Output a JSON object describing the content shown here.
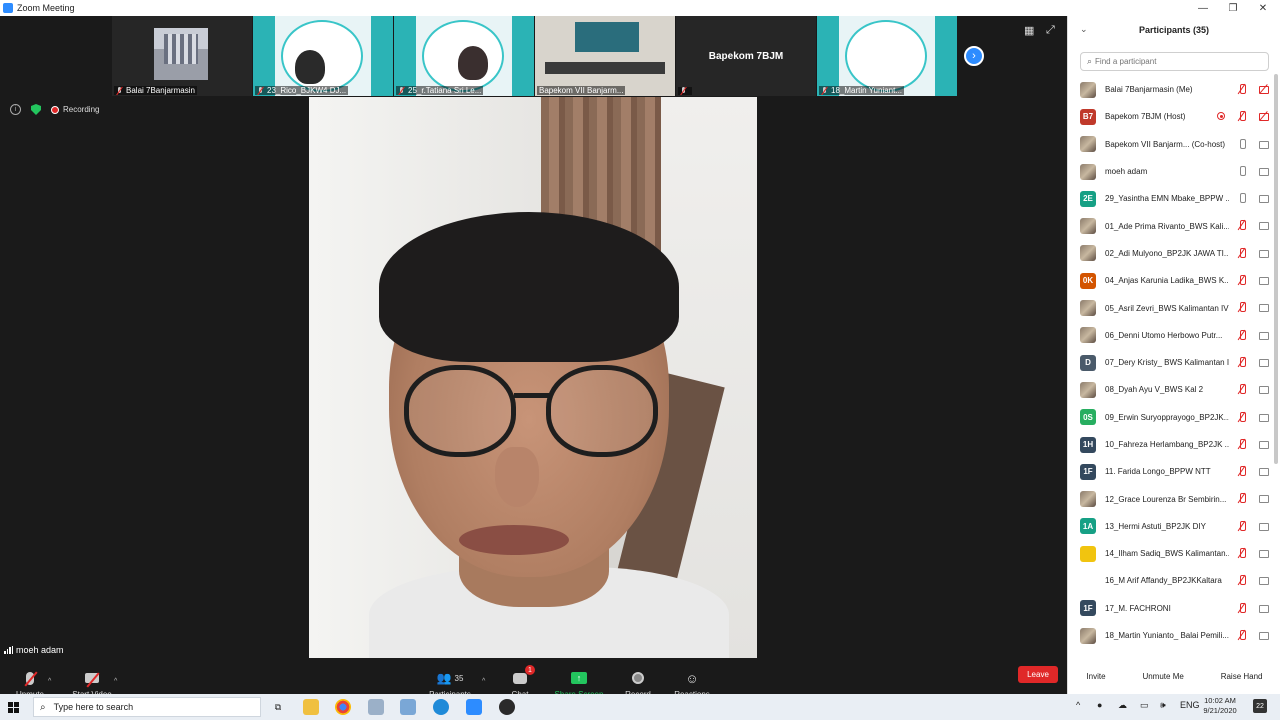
{
  "window": {
    "title": "Zoom Meeting",
    "minimize": "—",
    "restore": "❐",
    "close": "✕"
  },
  "thumbnails": [
    {
      "label": "Balai 7Banjarmasin",
      "kind": "building"
    },
    {
      "label": "23_Rico_BJKW4 DJ...",
      "kind": "slide-person"
    },
    {
      "label": "25_r.Tatiana Sri Le...",
      "kind": "slide-person"
    },
    {
      "label": "Bapekom VII Banjarm...",
      "kind": "room"
    },
    {
      "label": "Bapekom 7BJM",
      "kind": "name-only"
    },
    {
      "label": "18_Martin Yuniant...",
      "kind": "slide"
    }
  ],
  "status": {
    "recording_label": "Recording"
  },
  "speaker": {
    "name": "moeh adam"
  },
  "toolbar": {
    "unmute": "Unmute",
    "start_video": "Start Video",
    "participants": "Participants",
    "participants_count": "35",
    "chat": "Chat",
    "chat_badge": "1",
    "share_screen": "Share Screen",
    "record": "Record",
    "reactions": "Reactions",
    "leave": "Leave"
  },
  "panel": {
    "title": "Participants (35)",
    "search_placeholder": "Find a participant",
    "participants": [
      {
        "name": "Balai 7Banjarmasin (Me)",
        "avatar": "",
        "avatar_color": "photo",
        "mic": "off",
        "cam": "off"
      },
      {
        "name": "Bapekom 7BJM (Host)",
        "avatar": "B7",
        "avatar_color": "#c0392b",
        "mic": "off",
        "cam": "off",
        "rec": true
      },
      {
        "name": "Bapekom VII Banjarm... (Co-host)",
        "avatar": "",
        "avatar_color": "photo",
        "mic": "on",
        "cam": "on"
      },
      {
        "name": "moeh adam",
        "avatar": "",
        "avatar_color": "photo",
        "mic": "on",
        "cam": "on"
      },
      {
        "name": "29_Yasintha EMN Mbake_BPPW ...",
        "avatar": "2E",
        "avatar_color": "#16a085",
        "mic": "on",
        "cam": "on"
      },
      {
        "name": "01_Ade Prima Rivanto_BWS Kali...",
        "avatar": "",
        "avatar_color": "photo",
        "mic": "off",
        "cam": "on"
      },
      {
        "name": "02_Adi Mulyono_BP2JK JAWA TI...",
        "avatar": "",
        "avatar_color": "photo",
        "mic": "off",
        "cam": "on"
      },
      {
        "name": "04_Anjas Karunia Ladika_BWS K...",
        "avatar": "0K",
        "avatar_color": "#d35400",
        "mic": "off",
        "cam": "on"
      },
      {
        "name": "05_Asril Zevri_BWS Kalimantan IV",
        "avatar": "",
        "avatar_color": "photo",
        "mic": "off",
        "cam": "on"
      },
      {
        "name": "06_Denni Utomo Herbowo Putr...",
        "avatar": "",
        "avatar_color": "photo",
        "mic": "off",
        "cam": "on"
      },
      {
        "name": "07_Dery Kristy_ BWS Kalimantan II",
        "avatar": "D",
        "avatar_color": "#4a5a6a",
        "mic": "off",
        "cam": "on"
      },
      {
        "name": "08_Dyah Ayu V_BWS Kal 2",
        "avatar": "",
        "avatar_color": "photo",
        "mic": "off",
        "cam": "on"
      },
      {
        "name": "09_Erwin Suryopprayogo_BP2JK...",
        "avatar": "0S",
        "avatar_color": "#27ae60",
        "mic": "off",
        "cam": "on"
      },
      {
        "name": "10_Fahreza Herlambang_BP2JK ...",
        "avatar": "1H",
        "avatar_color": "#34495e",
        "mic": "off",
        "cam": "on"
      },
      {
        "name": "11. Farida Longo_BPPW NTT",
        "avatar": "1F",
        "avatar_color": "#34495e",
        "mic": "off",
        "cam": "on"
      },
      {
        "name": "12_Grace Lourenza Br Sembirin...",
        "avatar": "",
        "avatar_color": "photo",
        "mic": "off",
        "cam": "on"
      },
      {
        "name": "13_Hermi Astuti_BP2JK DIY",
        "avatar": "1A",
        "avatar_color": "#16a085",
        "mic": "off",
        "cam": "on"
      },
      {
        "name": "14_Ilham Sadiq_BWS Kalimantan...",
        "avatar": "",
        "avatar_color": "#f1c40f",
        "mic": "off",
        "cam": "on"
      },
      {
        "name": "16_M Arif Affandy_BP2JKKaltara",
        "avatar": "",
        "avatar_color": "#ffffff",
        "mic": "off",
        "cam": "on"
      },
      {
        "name": "17_M. FACHRONI",
        "avatar": "1F",
        "avatar_color": "#34495e",
        "mic": "off",
        "cam": "on"
      },
      {
        "name": "18_Martin Yunianto_ Balai Pemili...",
        "avatar": "",
        "avatar_color": "photo",
        "mic": "off",
        "cam": "on"
      }
    ],
    "invite": "Invite",
    "unmute_me": "Unmute Me",
    "raise_hand": "Raise Hand"
  },
  "taskbar": {
    "search_placeholder": "Type here to search",
    "lang": "ENG",
    "time": "10:02 AM",
    "date": "9/21/2020",
    "notif_count": "22"
  }
}
